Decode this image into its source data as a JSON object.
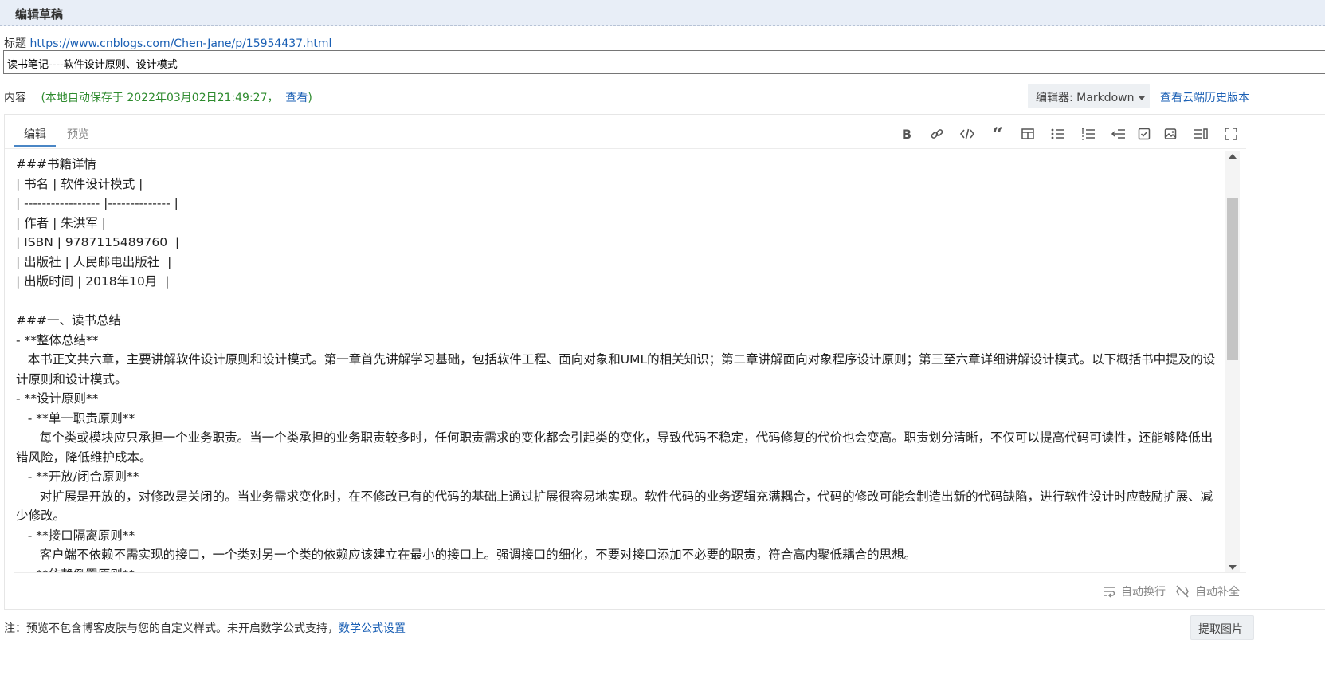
{
  "header": {
    "title": "编辑草稿"
  },
  "title_field": {
    "label": "标题",
    "url": "https://www.cnblogs.com/Chen-Jane/p/15954437.html",
    "value": "读书笔记----软件设计原则、设计模式"
  },
  "content_bar": {
    "label": "内容",
    "autosave_prefix": "(本地自动保存于 2022年03月02日21:49:27，",
    "autosave_link": "查看",
    "autosave_suffix": ")",
    "editor_select": "编辑器: Markdown",
    "history_link": "查看云端历史版本"
  },
  "editor": {
    "tabs": [
      {
        "label": "编辑",
        "active": true
      },
      {
        "label": "预览",
        "active": false
      }
    ],
    "toolbar": [
      {
        "name": "bold-icon",
        "glyph": "B"
      },
      {
        "name": "link-icon",
        "glyph": "🔗"
      },
      {
        "name": "code-icon",
        "glyph": "</>"
      },
      {
        "name": "quote-icon",
        "glyph": "“"
      },
      {
        "name": "table-icon",
        "glyph": "▦"
      },
      {
        "name": "unordered-list-icon",
        "glyph": "☰"
      },
      {
        "name": "ordered-list-icon",
        "glyph": "≡"
      },
      {
        "name": "indent-icon",
        "glyph": "⇤"
      },
      {
        "name": "checkbox-icon",
        "glyph": "☑"
      },
      {
        "name": "image-icon",
        "glyph": "▨"
      },
      {
        "name": "side-by-side-icon",
        "glyph": "▥"
      },
      {
        "name": "fullscreen-icon",
        "glyph": "⤢"
      }
    ],
    "lines": [
      "###书籍详情",
      "| 书名 | 软件设计模式 |",
      "| ----------------- |-------------- |",
      "| 作者 | 朱洪军 |",
      "| ISBN | 9787115489760  |",
      "| 出版社 | 人民邮电出版社  |",
      "| 出版时间 | 2018年10月  |",
      "",
      "###一、读书总结",
      "- **整体总结**",
      "   本书正文共六章，主要讲解软件设计原则和设计模式。第一章首先讲解学习基础，包括软件工程、面向对象和UML的相关知识；第二章讲解面向对象程序设计原则；第三至六章详细讲解设计模式。以下概括书中提及的设计原则和设计模式。",
      "- **设计原则**",
      "   - **单一职责原则**",
      "      每个类或模块应只承担一个业务职责。当一个类承担的业务职责较多时，任何职责需求的变化都会引起类的变化，导致代码不稳定，代码修复的代价也会变高。职责划分清晰，不仅可以提高代码可读性，还能够降低出错风险，降低维护成本。",
      "   - **开放/闭合原则**",
      "      对扩展是开放的，对修改是关闭的。当业务需求变化时，在不修改已有的代码的基础上通过扩展很容易地实现。软件代码的业务逻辑充满耦合，代码的修改可能会制造出新的代码缺陷，进行软件设计时应鼓励扩展、减少修改。",
      "   - **接口隔离原则**",
      "      客户端不依赖不需实现的接口，一个类对另一个类的依赖应该建立在最小的接口上。强调接口的细化，不要对接口添加不必要的职责，符合高内聚低耦合的思想。",
      "   - **依赖倒置原则**"
    ],
    "footer": {
      "auto_wrap": "自动换行",
      "auto_complete": "自动补全"
    }
  },
  "footer": {
    "note": "注：预览不包含博客皮肤与您的自定义样式。未开启数学公式支持，",
    "math_link": "数学公式设置",
    "fetch_button": "提取图片"
  }
}
